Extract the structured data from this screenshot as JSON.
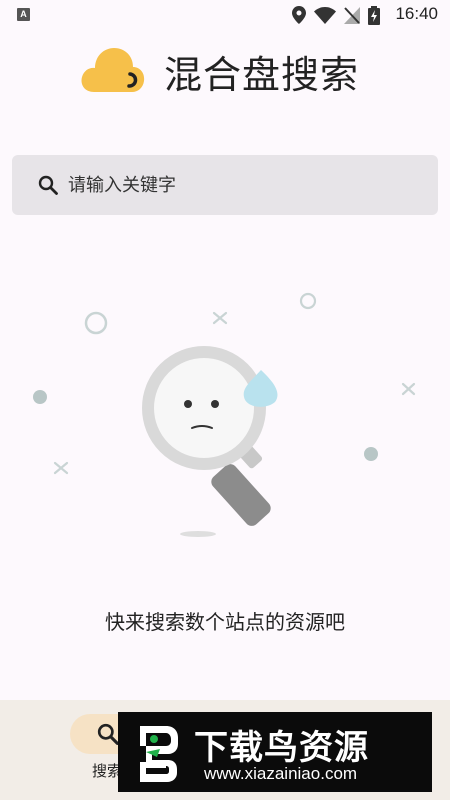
{
  "status_bar": {
    "time": "16:40",
    "icons": [
      "notification-a-icon",
      "location-icon",
      "wifi-icon",
      "no-sim-icon",
      "battery-charging-icon"
    ],
    "notification_glyph": "A"
  },
  "header": {
    "title": "混合盘搜索",
    "logo_color": "#f6c04a"
  },
  "search": {
    "placeholder": "请输入关键字",
    "value": ""
  },
  "empty_state": {
    "message": "快来搜索数个站点的资源吧"
  },
  "bottom_nav": {
    "items": [
      {
        "label": "搜索",
        "icon": "search-icon",
        "active": true
      }
    ],
    "active_color": "#f6e2c5"
  },
  "watermark": {
    "title": "下载鸟资源",
    "url": "www.xiazainiao.com"
  }
}
